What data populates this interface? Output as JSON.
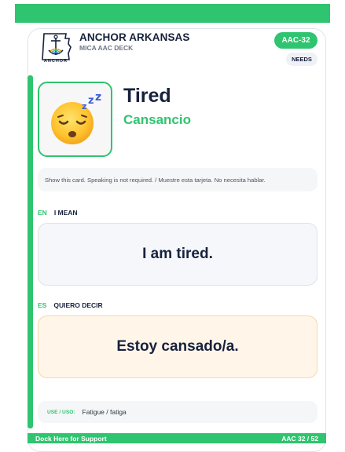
{
  "colors": {
    "accent": "#2fc46f",
    "navy": "#17213d",
    "english_bg": "#f5f7fa",
    "spanish_bg": "#fff6e9"
  },
  "header": {
    "logo_icon": "anchor-arkansas-logo",
    "logo_word": "ANCHOR",
    "org_name": "ANCHOR ARKANSAS",
    "deck_name": "MICA AAC DECK",
    "card_code": "AAC-32",
    "category": "NEEDS"
  },
  "card": {
    "emoji_icon": "sleeping-face-icon",
    "word_en": "Tired",
    "word_es": "Cansancio",
    "instruction": "Show this card. Speaking is not required. / Muestre esta tarjeta. No necesita hablar."
  },
  "english": {
    "code": "EN",
    "label": "I MEAN",
    "phrase": "I am tired."
  },
  "spanish": {
    "code": "ES",
    "label": "QUIERO DECIR",
    "phrase": "Estoy cansado/a."
  },
  "use": {
    "label": "USE / USO:",
    "value": "Fatigue / fatiga"
  },
  "footer": {
    "left": "Dock Here for Support",
    "right": "AAC 32 / 52"
  }
}
